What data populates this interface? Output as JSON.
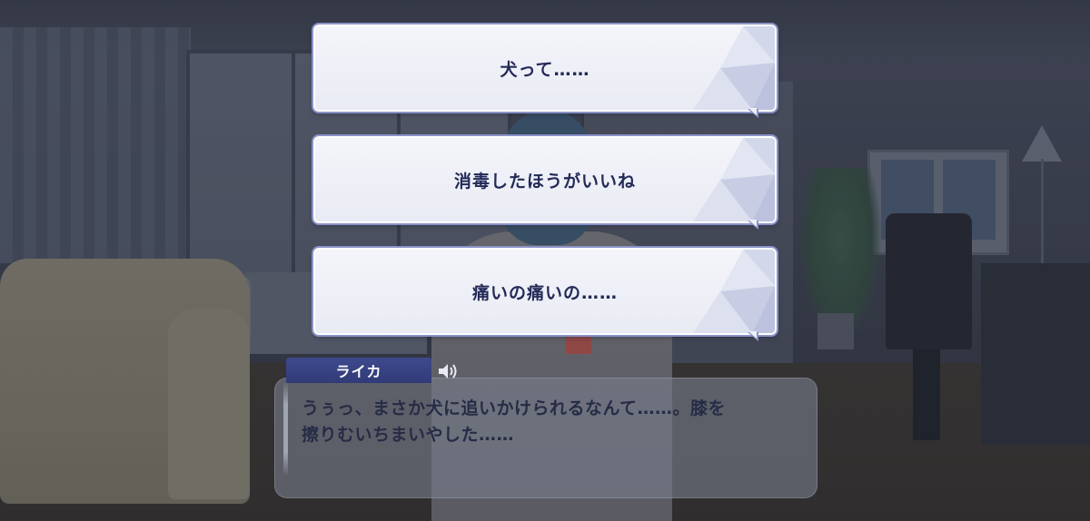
{
  "choices": [
    {
      "label": "犬って……"
    },
    {
      "label": "消毒したほうがいいね"
    },
    {
      "label": "痛いの痛いの……"
    }
  ],
  "dialogue": {
    "speaker": "ライカ",
    "text": "うぅっ、まさか犬に追いかけられるなんて……。膝を\n擦りむいちまいやした……"
  },
  "icons": {
    "voice": "speaker-icon"
  },
  "colors": {
    "choice_text": "#232a58",
    "choice_border": "#8b92c8",
    "name_plate": "#3e4a8c",
    "dialogue_text": "#262c45"
  }
}
